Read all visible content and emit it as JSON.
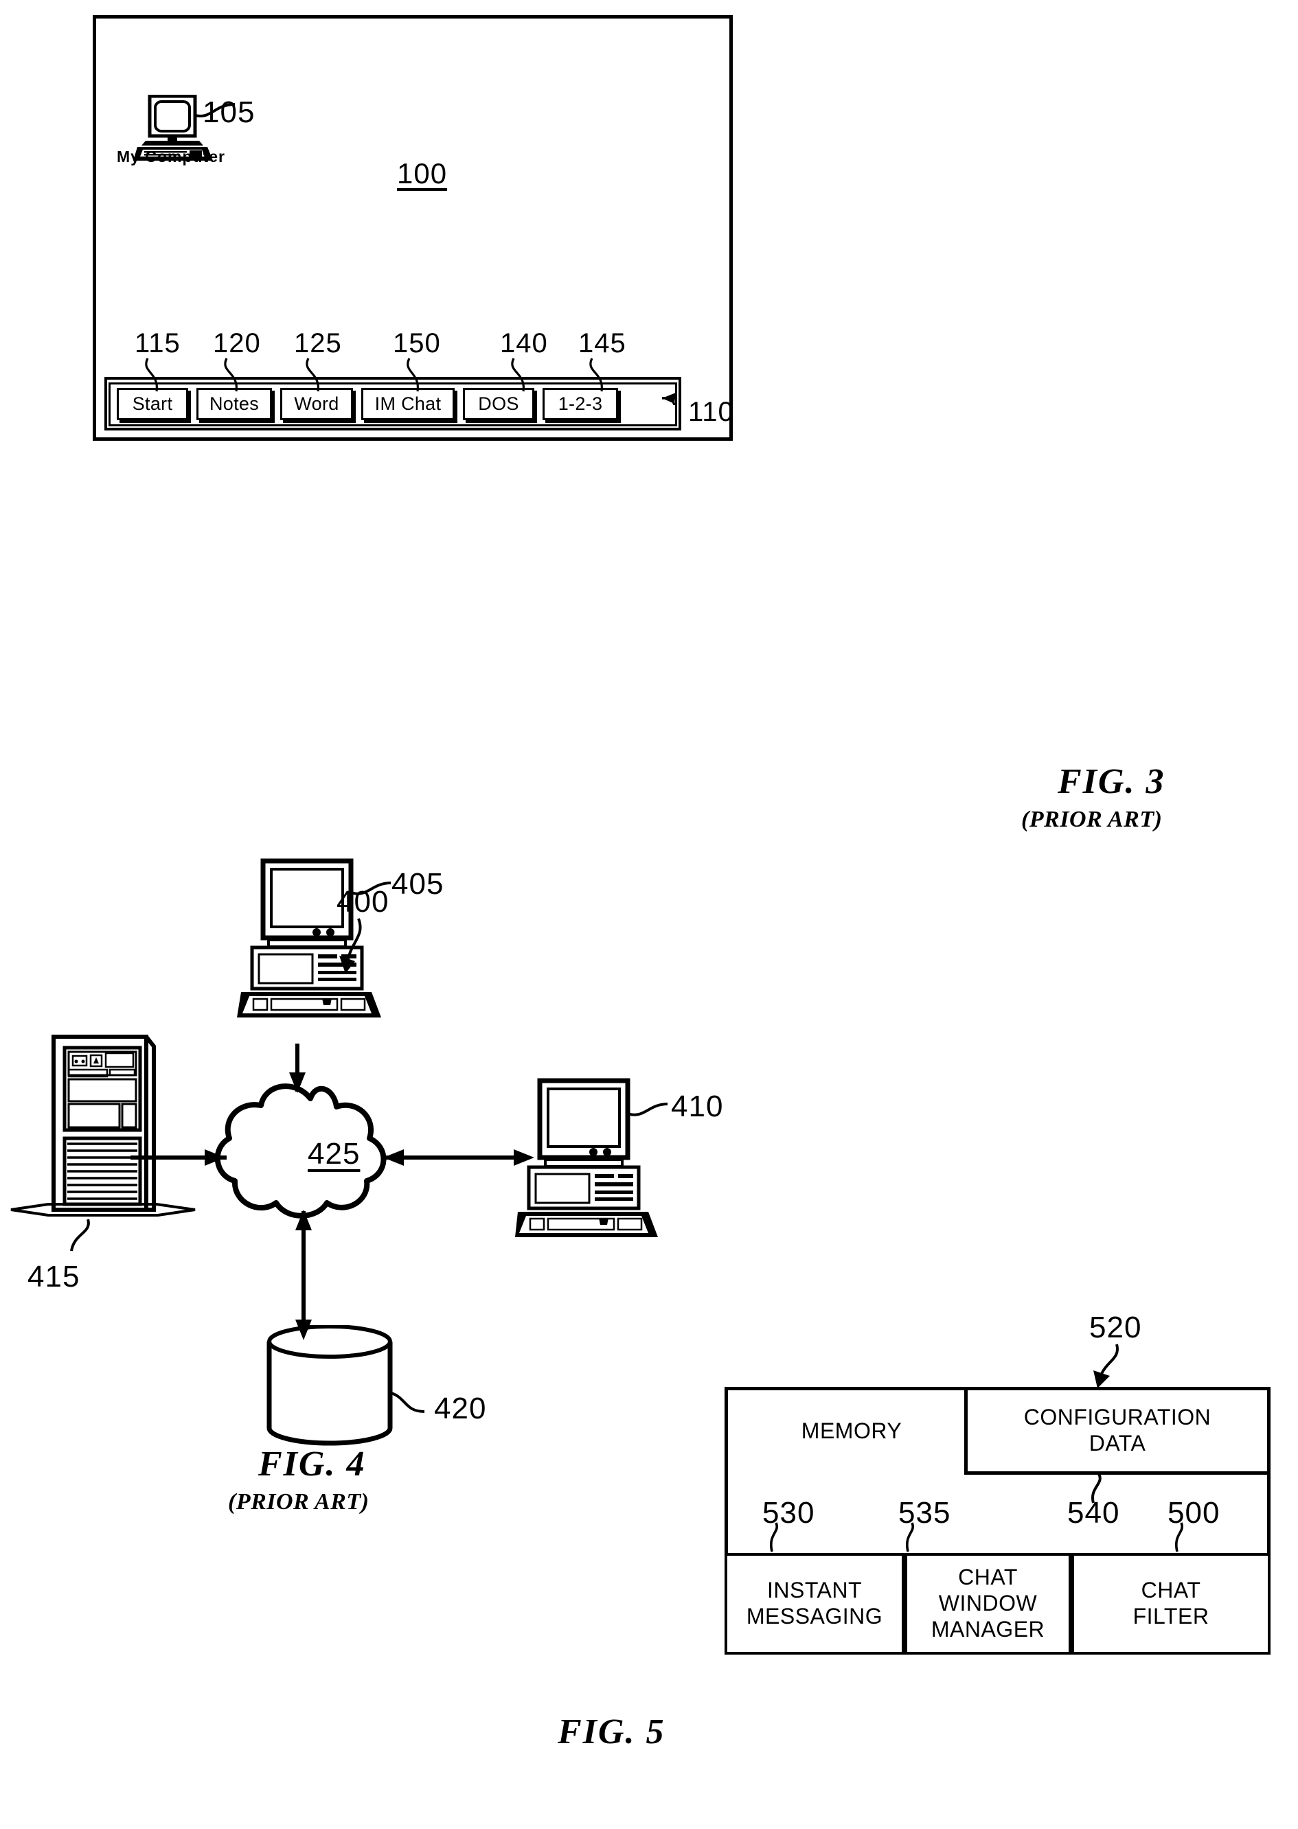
{
  "figures": [
    {
      "id": "fig3",
      "caption": "FIG. 3",
      "subcaption": "(PRIOR ART)"
    },
    {
      "id": "fig4",
      "caption": "FIG. 4",
      "subcaption": "(PRIOR ART)"
    },
    {
      "id": "fig5",
      "caption": "FIG. 5",
      "subcaption": ""
    }
  ],
  "fig3": {
    "screen_ref": "100",
    "desktop_icon": {
      "label": "My Computer",
      "ref": "105"
    },
    "taskbar": {
      "ref": "110",
      "buttons": [
        {
          "label": "Start",
          "ref": "115"
        },
        {
          "label": "Notes",
          "ref": "120"
        },
        {
          "label": "Word",
          "ref": "125"
        },
        {
          "label": "IM Chat",
          "ref": "150"
        },
        {
          "label": "DOS",
          "ref": "140"
        },
        {
          "label": "1-2-3",
          "ref": "145"
        }
      ]
    },
    "caption": "FIG. 3",
    "subcaption": "(PRIOR ART)"
  },
  "fig4": {
    "system_ref": "400",
    "nodes": [
      {
        "name": "workstation-top",
        "ref": "405"
      },
      {
        "name": "workstation-right",
        "ref": "410"
      },
      {
        "name": "server-tower",
        "ref": "415"
      },
      {
        "name": "database",
        "ref": "420"
      },
      {
        "name": "network-cloud",
        "ref": "425",
        "label": "425"
      }
    ],
    "caption": "FIG. 4",
    "subcaption": "(PRIOR ART)"
  },
  "fig5": {
    "caption": "FIG. 5",
    "memory_label": "MEMORY",
    "memory_ref": "500",
    "config_data": {
      "label": "CONFIGURATION\nDATA",
      "line1": "CONFIGURATION",
      "line2": "DATA",
      "ref": "520"
    },
    "modules": [
      {
        "line1": "INSTANT",
        "line2": "MESSAGING",
        "line3": "",
        "ref": "530"
      },
      {
        "line1": "CHAT",
        "line2": "WINDOW",
        "line3": "MANAGER",
        "ref": "535"
      },
      {
        "line1": "CHAT",
        "line2": "FILTER",
        "line3": "",
        "ref": "500"
      }
    ],
    "inner_ref": "540",
    "outer_ref": "500"
  },
  "colors": {
    "ink": "#000000",
    "paper": "#ffffff"
  }
}
